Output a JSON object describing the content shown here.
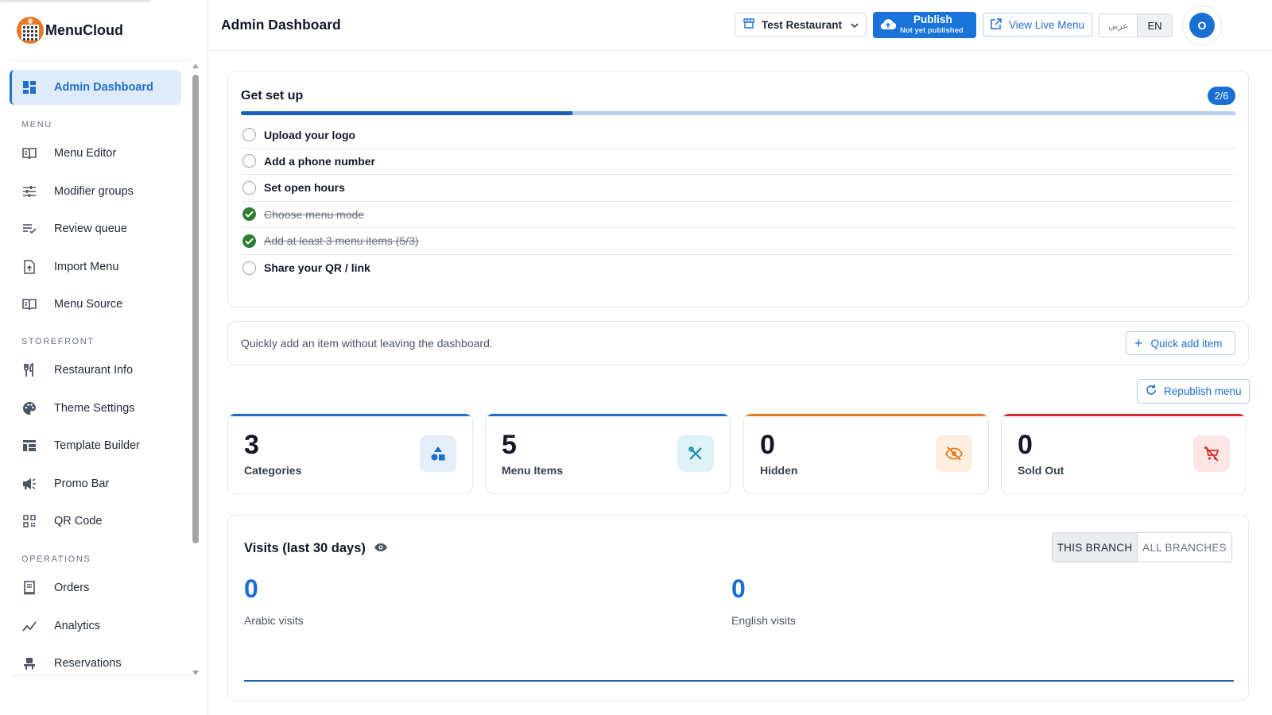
{
  "brand": {
    "name": "MenuCloud"
  },
  "sidebar": {
    "active": {
      "label": "Admin Dashboard",
      "icon": "dashboard-icon"
    },
    "sections": {
      "menu": "MENU",
      "storefront": "STOREFRONT",
      "operations": "OPERATIONS"
    },
    "items": [
      {
        "label": "Menu Editor",
        "icon": "book-icon"
      },
      {
        "label": "Modifier groups",
        "icon": "sliders-icon"
      },
      {
        "label": "Review queue",
        "icon": "checklist-icon"
      },
      {
        "label": "Import Menu",
        "icon": "file-import-icon"
      },
      {
        "label": "Menu Source",
        "icon": "book-icon"
      },
      {
        "label": "Restaurant Info",
        "icon": "utensils-icon"
      },
      {
        "label": "Theme Settings",
        "icon": "palette-icon"
      },
      {
        "label": "Template Builder",
        "icon": "template-icon"
      },
      {
        "label": "Promo Bar",
        "icon": "megaphone-icon"
      },
      {
        "label": "QR Code",
        "icon": "qr-icon"
      },
      {
        "label": "Orders",
        "icon": "receipt-icon"
      },
      {
        "label": "Analytics",
        "icon": "trend-icon"
      },
      {
        "label": "Reservations",
        "icon": "chair-icon"
      }
    ]
  },
  "header": {
    "title": "Admin Dashboard",
    "restaurant": "Test Restaurant",
    "publish": {
      "label": "Publish",
      "status": "Not yet published"
    },
    "live_menu": "View Live Menu",
    "lang_ar": "عربي",
    "lang_en": "EN",
    "avatar_initial": "O"
  },
  "setup": {
    "title": "Get set up",
    "badge": "2/6",
    "progress_fraction": 0.333,
    "tasks": [
      {
        "label": "Upload your logo",
        "done": false
      },
      {
        "label": "Add a phone number",
        "done": false
      },
      {
        "label": "Set open hours",
        "done": false
      },
      {
        "label": "Choose menu mode",
        "done": true
      },
      {
        "label": "Add at least 3 menu items (5/3)",
        "done": true
      },
      {
        "label": "Share your QR / link",
        "done": false
      }
    ]
  },
  "quick_add": {
    "text": "Quickly add an item without leaving the dashboard.",
    "button": "Quick add item"
  },
  "republish": "Republish menu",
  "stats": [
    {
      "value": "3",
      "label": "Categories",
      "accent": "#1f6fd1",
      "icon": "shapes-icon"
    },
    {
      "value": "5",
      "label": "Menu Items",
      "accent": "#1f6fd1",
      "icon": "utensils-cross-icon"
    },
    {
      "value": "0",
      "label": "Hidden",
      "accent": "#e57c23",
      "icon": "eye-off-icon"
    },
    {
      "value": "0",
      "label": "Sold Out",
      "accent": "#d32f2f",
      "icon": "cart-off-icon"
    }
  ],
  "visits": {
    "title": "Visits (last 30 days)",
    "toggle_this": "THIS BRANCH",
    "toggle_all": "ALL BRANCHES",
    "arabic": {
      "value": "0",
      "label": "Arabic visits"
    },
    "english": {
      "value": "0",
      "label": "English visits"
    }
  }
}
